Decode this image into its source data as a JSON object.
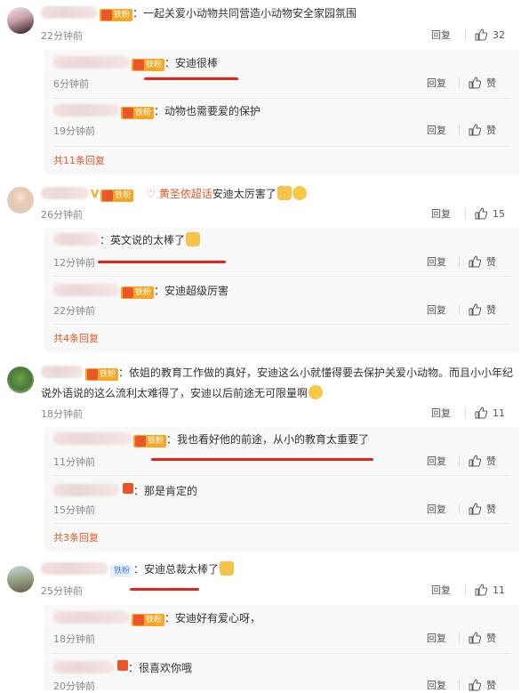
{
  "common": {
    "reply_label": "回复",
    "like_label": "赞",
    "badge_label": "铁粉"
  },
  "comments": [
    {
      "text": "：一起关爱小动物共同营造小动物安全家园氛围",
      "time": "22分钟前",
      "likes": "32",
      "replies": [
        {
          "text": "：安迪很棒",
          "time": "6分钟前"
        },
        {
          "text": "：动物也需要爱的保护",
          "time": "19分钟前"
        }
      ],
      "more": "共11条回复"
    },
    {
      "prefix": "V",
      "super": "♡ 黄圣依超话",
      "text": "安迪太厉害了",
      "time": "26分钟前",
      "likes": "15",
      "replies": [
        {
          "text": "：英文说的太棒了",
          "time": "12分钟前"
        },
        {
          "text": "：安迪超级厉害",
          "time": "22分钟前"
        }
      ],
      "more": "共4条回复"
    },
    {
      "text_line1": "：依姐的教育工作做的真好，安迪这么小就懂得要去保护关爱小动物。而且小小年纪",
      "text_line2": "说外语说的这么流利太难得了，安迪以后前途无可限量啊",
      "time": "18分钟前",
      "likes": "11",
      "replies": [
        {
          "text": "：我也看好他的前途，从小的教育太重要了",
          "time": "11分钟前"
        },
        {
          "text": "：那是肯定的",
          "time": "15分钟前"
        }
      ],
      "more": "共3条回复"
    },
    {
      "text": "：安迪总裁太棒了",
      "time": "25分钟前",
      "likes": "11",
      "replies": [
        {
          "text": "：安迪好有爱心呀，",
          "time": "18分钟前"
        },
        {
          "text": "：很喜欢你哦",
          "time": "20分钟前"
        }
      ]
    }
  ],
  "colors": {
    "accent": "#e8562a",
    "highlight_line": "#e8221a",
    "reply_bg": "#f8f8f8"
  }
}
